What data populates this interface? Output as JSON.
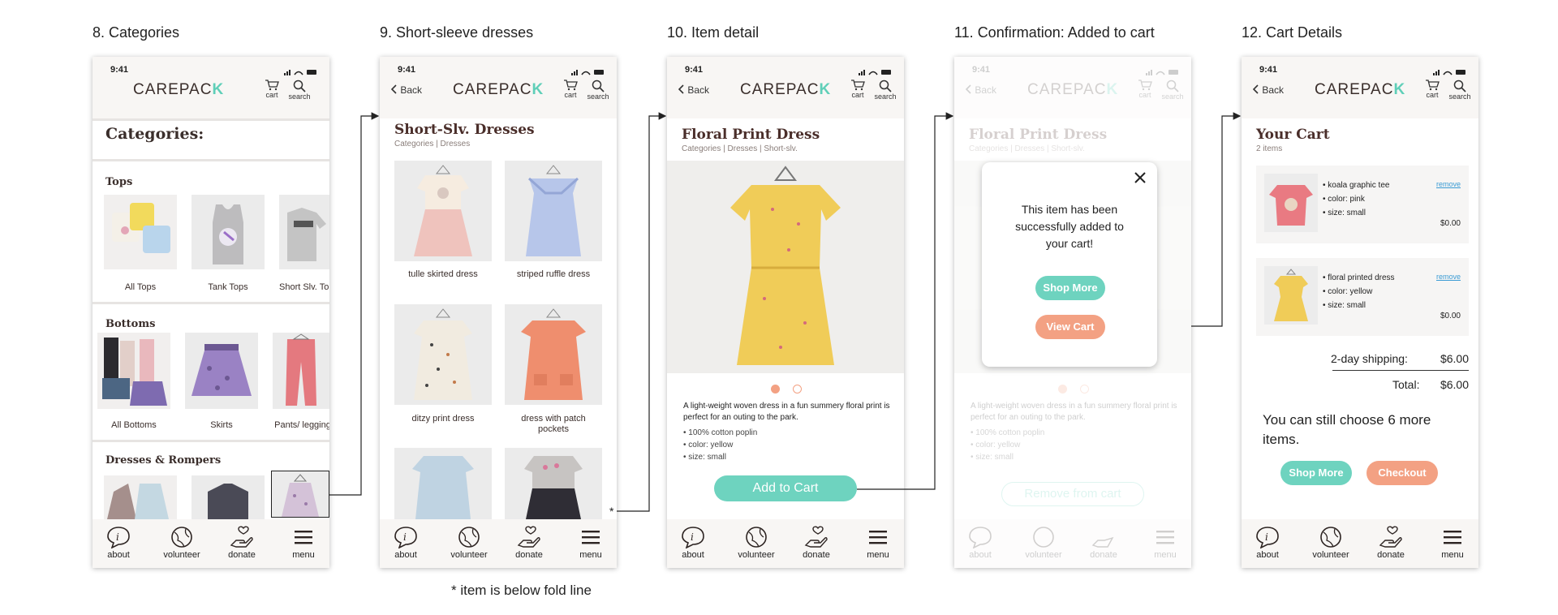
{
  "screens": [
    {
      "title": "8. Categories"
    },
    {
      "title": "9. Short-sleeve dresses"
    },
    {
      "title": "10. Item detail"
    },
    {
      "title": "11. Confirmation: Added to cart"
    },
    {
      "title": "12. Cart Details"
    }
  ],
  "common": {
    "time": "9:41",
    "logo_text": "CAREPAC",
    "logo_k": "K",
    "cart_label": "cart",
    "search_label": "search",
    "back_label": "Back",
    "nav": {
      "about": "about",
      "volunteer": "volunteer",
      "donate": "donate",
      "menu": "menu"
    }
  },
  "categories": {
    "heading": "Categories:",
    "sections": [
      {
        "title": "Tops",
        "items": [
          "All Tops",
          "Tank Tops",
          "Short Slv. To"
        ]
      },
      {
        "title": "Bottoms",
        "items": [
          "All Bottoms",
          "Skirts",
          "Pants/ legging"
        ]
      },
      {
        "title": "Dresses & Rompers"
      }
    ]
  },
  "dresses": {
    "heading": "Short-Slv. Dresses",
    "breadcrumb": "Categories | Dresses",
    "items": [
      "tulle skirted dress",
      "striped ruffle dress",
      "ditzy print dress",
      "dress with patch pockets"
    ]
  },
  "detail": {
    "heading": "Floral Print Dress",
    "breadcrumb": "Categories | Dresses | Short-slv.",
    "description": "A light-weight woven dress in a fun summery floral print is perfect for an outing to the park.",
    "specs": [
      "• 100% cotton poplin",
      "• color: yellow",
      "• size: small"
    ],
    "add_to_cart": "Add to Cart"
  },
  "confirm": {
    "message": "This item has been successfully added to your cart!",
    "shop_more": "Shop More",
    "view_cart": "View Cart",
    "remove_label": "Remove from cart"
  },
  "cart": {
    "heading": "Your Cart",
    "count": "2 items",
    "items": [
      {
        "name": "• koala graphic tee",
        "color": "• color: pink",
        "size": "• size: small",
        "price": "$0.00",
        "remove": "remove"
      },
      {
        "name": "• floral printed dress",
        "color": "• color: yellow",
        "size": "• size: small",
        "price": "$0.00",
        "remove": "remove"
      }
    ],
    "shipping_label": "2-day shipping:",
    "shipping_value": "$6.00",
    "total_label": "Total:",
    "total_value": "$6.00",
    "note": "You can still choose 6 more items.",
    "shop_more": "Shop More",
    "checkout": "Checkout"
  },
  "footnote": "* item is below fold line",
  "colors": {
    "teal": "#6ed3bf",
    "coral": "#f3a183",
    "pagination_active": "#f3a183",
    "text": "#3a2e2b"
  }
}
